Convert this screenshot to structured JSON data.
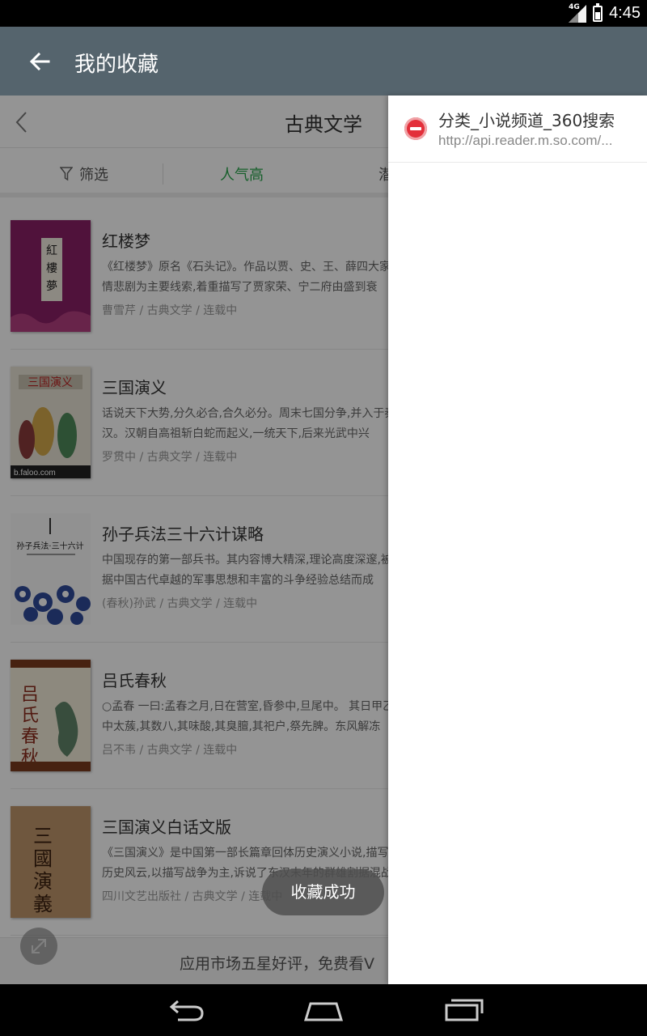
{
  "status_bar": {
    "network": "4G",
    "time": "4:45"
  },
  "app_bar": {
    "title": "我的收藏",
    "back_icon": "arrow-left-icon"
  },
  "category": {
    "title": "古典文学",
    "filters": [
      {
        "label": "筛选",
        "icon": "filter-icon"
      },
      {
        "label": "人气高",
        "active": true
      },
      {
        "label": "潜"
      }
    ]
  },
  "books": [
    {
      "title": "红楼梦",
      "desc": "《红楼梦》原名《石头记》。作品以贾、史、王、薛四大家族的兴衰为背景，以贾宝玉和林黛玉爱情悲剧为主要线索,着重描写了贾家荣、宁二府由盛到衰",
      "meta": "曹雪芹 / 古典文学 / 连载中"
    },
    {
      "title": "三国演义",
      "desc": "话说天下大势,分久必合,合久必分。周末七国分争,并入于秦。及秦灭之后,楚、汉分争,又并入于汉。汉朝自高祖斩白蛇而起义,一统天下,后来光武中兴",
      "meta": "罗贯中 / 古典文学 / 连载中"
    },
    {
      "title": "孙子兵法三十六计谋略",
      "desc": "中国现存的第一部兵书。其内容博大精深,理论高度深邃,被誉为兵学圣典。而《三十六计》则是根据中国古代卓越的军事思想和丰富的斗争经验总结而成",
      "meta": "(春秋)孙武 / 古典文学 / 连载中"
    },
    {
      "title": "吕氏春秋",
      "desc": "○孟春 一曰:孟春之月,日在营室,昏参中,旦尾中。 其日甲乙,其帝太皞,其神句芒,其虫鳞,其音角,律中太蔟,其数八,其味酸,其臭膻,其祀户,祭先脾。东风解冻",
      "meta": "吕不韦 / 古典文学 / 连载中"
    },
    {
      "title": "三国演义白话文版",
      "desc": "《三国演义》是中国第一部长篇章回体历史演义小说,描写了从东汉末年到西晋初年之间近百年的历史风云,以描写战争为主,诉说了东汉末年的群雄割据混战和魏、蜀、吴三个政治集团之间的政治和军事斗争,分为黄巾起义",
      "meta": "四川文艺出版社 / 古典文学 / 连载中"
    }
  ],
  "banner": {
    "text": "应用市场五星好评，免费看V"
  },
  "toast": {
    "text": "收藏成功"
  },
  "bookmark_panel": {
    "items": [
      {
        "title": "分类_小说频道_360搜索",
        "url": "http://api.reader.m.so.com/...",
        "icon": "remove-icon"
      }
    ]
  },
  "nav_bar": {
    "back_icon": "back-icon",
    "home_icon": "home-icon",
    "recents_icon": "recents-icon"
  },
  "colors": {
    "app_bar": "#55646d",
    "accent_green": "#27a44a",
    "remove_red": "#e32f3a"
  }
}
